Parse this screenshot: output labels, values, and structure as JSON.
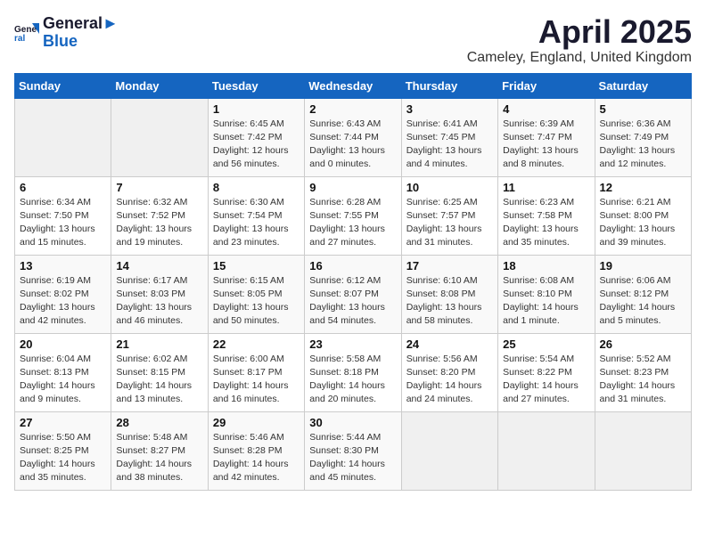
{
  "header": {
    "logo_general": "General",
    "logo_blue": "Blue",
    "title": "April 2025",
    "subtitle": "Cameley, England, United Kingdom"
  },
  "weekdays": [
    "Sunday",
    "Monday",
    "Tuesday",
    "Wednesday",
    "Thursday",
    "Friday",
    "Saturday"
  ],
  "weeks": [
    [
      {
        "day": "",
        "info": ""
      },
      {
        "day": "",
        "info": ""
      },
      {
        "day": "1",
        "info": "Sunrise: 6:45 AM\nSunset: 7:42 PM\nDaylight: 12 hours\nand 56 minutes."
      },
      {
        "day": "2",
        "info": "Sunrise: 6:43 AM\nSunset: 7:44 PM\nDaylight: 13 hours\nand 0 minutes."
      },
      {
        "day": "3",
        "info": "Sunrise: 6:41 AM\nSunset: 7:45 PM\nDaylight: 13 hours\nand 4 minutes."
      },
      {
        "day": "4",
        "info": "Sunrise: 6:39 AM\nSunset: 7:47 PM\nDaylight: 13 hours\nand 8 minutes."
      },
      {
        "day": "5",
        "info": "Sunrise: 6:36 AM\nSunset: 7:49 PM\nDaylight: 13 hours\nand 12 minutes."
      }
    ],
    [
      {
        "day": "6",
        "info": "Sunrise: 6:34 AM\nSunset: 7:50 PM\nDaylight: 13 hours\nand 15 minutes."
      },
      {
        "day": "7",
        "info": "Sunrise: 6:32 AM\nSunset: 7:52 PM\nDaylight: 13 hours\nand 19 minutes."
      },
      {
        "day": "8",
        "info": "Sunrise: 6:30 AM\nSunset: 7:54 PM\nDaylight: 13 hours\nand 23 minutes."
      },
      {
        "day": "9",
        "info": "Sunrise: 6:28 AM\nSunset: 7:55 PM\nDaylight: 13 hours\nand 27 minutes."
      },
      {
        "day": "10",
        "info": "Sunrise: 6:25 AM\nSunset: 7:57 PM\nDaylight: 13 hours\nand 31 minutes."
      },
      {
        "day": "11",
        "info": "Sunrise: 6:23 AM\nSunset: 7:58 PM\nDaylight: 13 hours\nand 35 minutes."
      },
      {
        "day": "12",
        "info": "Sunrise: 6:21 AM\nSunset: 8:00 PM\nDaylight: 13 hours\nand 39 minutes."
      }
    ],
    [
      {
        "day": "13",
        "info": "Sunrise: 6:19 AM\nSunset: 8:02 PM\nDaylight: 13 hours\nand 42 minutes."
      },
      {
        "day": "14",
        "info": "Sunrise: 6:17 AM\nSunset: 8:03 PM\nDaylight: 13 hours\nand 46 minutes."
      },
      {
        "day": "15",
        "info": "Sunrise: 6:15 AM\nSunset: 8:05 PM\nDaylight: 13 hours\nand 50 minutes."
      },
      {
        "day": "16",
        "info": "Sunrise: 6:12 AM\nSunset: 8:07 PM\nDaylight: 13 hours\nand 54 minutes."
      },
      {
        "day": "17",
        "info": "Sunrise: 6:10 AM\nSunset: 8:08 PM\nDaylight: 13 hours\nand 58 minutes."
      },
      {
        "day": "18",
        "info": "Sunrise: 6:08 AM\nSunset: 8:10 PM\nDaylight: 14 hours\nand 1 minute."
      },
      {
        "day": "19",
        "info": "Sunrise: 6:06 AM\nSunset: 8:12 PM\nDaylight: 14 hours\nand 5 minutes."
      }
    ],
    [
      {
        "day": "20",
        "info": "Sunrise: 6:04 AM\nSunset: 8:13 PM\nDaylight: 14 hours\nand 9 minutes."
      },
      {
        "day": "21",
        "info": "Sunrise: 6:02 AM\nSunset: 8:15 PM\nDaylight: 14 hours\nand 13 minutes."
      },
      {
        "day": "22",
        "info": "Sunrise: 6:00 AM\nSunset: 8:17 PM\nDaylight: 14 hours\nand 16 minutes."
      },
      {
        "day": "23",
        "info": "Sunrise: 5:58 AM\nSunset: 8:18 PM\nDaylight: 14 hours\nand 20 minutes."
      },
      {
        "day": "24",
        "info": "Sunrise: 5:56 AM\nSunset: 8:20 PM\nDaylight: 14 hours\nand 24 minutes."
      },
      {
        "day": "25",
        "info": "Sunrise: 5:54 AM\nSunset: 8:22 PM\nDaylight: 14 hours\nand 27 minutes."
      },
      {
        "day": "26",
        "info": "Sunrise: 5:52 AM\nSunset: 8:23 PM\nDaylight: 14 hours\nand 31 minutes."
      }
    ],
    [
      {
        "day": "27",
        "info": "Sunrise: 5:50 AM\nSunset: 8:25 PM\nDaylight: 14 hours\nand 35 minutes."
      },
      {
        "day": "28",
        "info": "Sunrise: 5:48 AM\nSunset: 8:27 PM\nDaylight: 14 hours\nand 38 minutes."
      },
      {
        "day": "29",
        "info": "Sunrise: 5:46 AM\nSunset: 8:28 PM\nDaylight: 14 hours\nand 42 minutes."
      },
      {
        "day": "30",
        "info": "Sunrise: 5:44 AM\nSunset: 8:30 PM\nDaylight: 14 hours\nand 45 minutes."
      },
      {
        "day": "",
        "info": ""
      },
      {
        "day": "",
        "info": ""
      },
      {
        "day": "",
        "info": ""
      }
    ]
  ]
}
